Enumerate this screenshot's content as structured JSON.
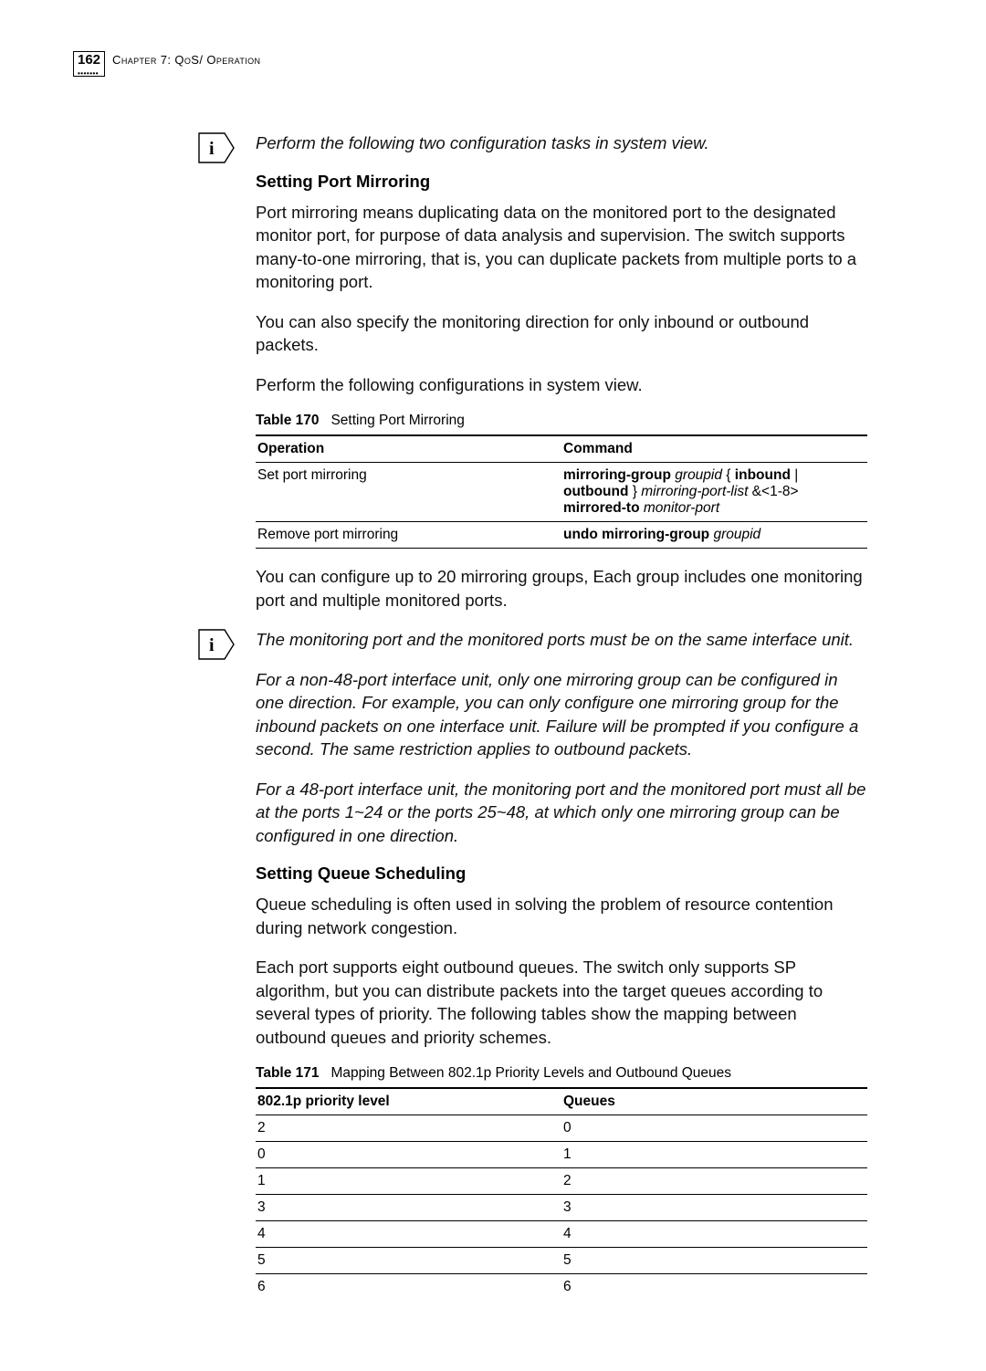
{
  "page_number": "162",
  "chapter_line": "Chapter 7: QoS/ Operation",
  "intro_italic": "Perform the following two configuration tasks in system view.",
  "section1": {
    "heading": "Setting Port Mirroring",
    "p1": "Port mirroring means duplicating data on the monitored port to the designated monitor port, for purpose of data analysis and supervision. The switch supports many-to-one mirroring, that is, you can duplicate packets from multiple ports to a monitoring port.",
    "p2": "You can also specify the monitoring direction for only inbound or outbound packets.",
    "p3": "Perform the following configurations in system view."
  },
  "table170": {
    "caption_label": "Table 170",
    "caption_text": "Setting Port Mirroring",
    "head_op": "Operation",
    "head_cmd": "Command",
    "rows": [
      {
        "op": "Set port mirroring",
        "cmd_html": "<b>mirroring-group</b> <i>groupid</i> { <b>inbound</b> | <b>outbound</b> } <i>mirroring-port-list</i> &amp;&lt;1-8&gt; <b>mirrored-to</b> <i>monitor-port</i>"
      },
      {
        "op": "Remove port mirroring",
        "cmd_html": "<b>undo mirroring-group</b> <i>groupid</i>"
      }
    ]
  },
  "after1": "You can configure up to 20 mirroring groups, Each group includes one monitoring port and multiple monitored ports.",
  "notes": {
    "n1": "The monitoring port and the monitored ports must be on the same interface unit.",
    "n2": "For a non-48-port interface unit, only one mirroring group can be configured in one direction. For example, you can only configure one mirroring group for the inbound packets on one interface unit. Failure will be prompted if you configure a second. The same restriction applies to outbound packets.",
    "n3": "For a 48-port interface unit, the monitoring port and the monitored port must all be at the ports 1~24 or the ports 25~48, at which only one mirroring group can be configured in one direction."
  },
  "section2": {
    "heading": "Setting Queue Scheduling",
    "p1": "Queue scheduling is often used in solving the problem of resource contention during network congestion.",
    "p2": "Each port supports eight outbound queues. The switch only supports SP algorithm, but you can distribute packets into the target queues according to several types of priority. The following tables show the mapping between outbound queues and priority schemes."
  },
  "table171": {
    "caption_label": "Table 171",
    "caption_text": "Mapping Between 802.1p Priority Levels and Outbound Queues",
    "head_level": "802.1p priority level",
    "head_q": "Queues",
    "rows": [
      {
        "level": "2",
        "q": "0"
      },
      {
        "level": "0",
        "q": "1"
      },
      {
        "level": "1",
        "q": "2"
      },
      {
        "level": "3",
        "q": "3"
      },
      {
        "level": "4",
        "q": "4"
      },
      {
        "level": "5",
        "q": "5"
      },
      {
        "level": "6",
        "q": "6"
      }
    ]
  }
}
